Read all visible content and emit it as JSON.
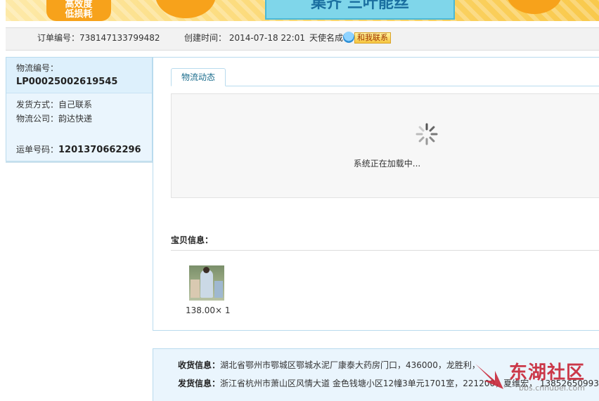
{
  "orderbar": {
    "order_no_label": "订单编号：",
    "order_no": "738147133799482",
    "created_label": "创建时间：",
    "created_time": "2014-07-18 22:01",
    "angel_name": "天使名成",
    "contact_label": "和我联系"
  },
  "logistics": {
    "no_label": "物流编号：",
    "no_value": "LP00025002619545",
    "ship_method_label": "发货方式：",
    "ship_method": "自己联系",
    "company_label": "物流公司：",
    "company": "韵达快递",
    "waybill_label": "运单号码：",
    "waybill_no": "1201370662296"
  },
  "tabs": [
    {
      "label": "物流动态",
      "active": true
    }
  ],
  "loading": {
    "text": "系统正在加载中..."
  },
  "goods": {
    "title": "宝贝信息：",
    "items": [
      {
        "price_qty": "138.00× 1"
      }
    ]
  },
  "address": {
    "receive_label": "收货信息：",
    "receive_text": "湖北省鄂州市鄂城区鄂城水泥厂康泰大药房门口，436000，龙胜利，",
    "send_label": "发货信息：",
    "send_text": "浙江省杭州市萧山区风情大道 金色钱塘小区12幢3单元1701室，221200，夏维宏， 13852650993"
  },
  "watermark": {
    "title": "东湖社区",
    "url": "bbs.cnhubei.com"
  },
  "colors": {
    "panel_border": "#b9dbee",
    "panel_bg": "#eaf5fd",
    "tab_text": "#1a6c8c",
    "watermark_red": "#c9283a"
  }
}
